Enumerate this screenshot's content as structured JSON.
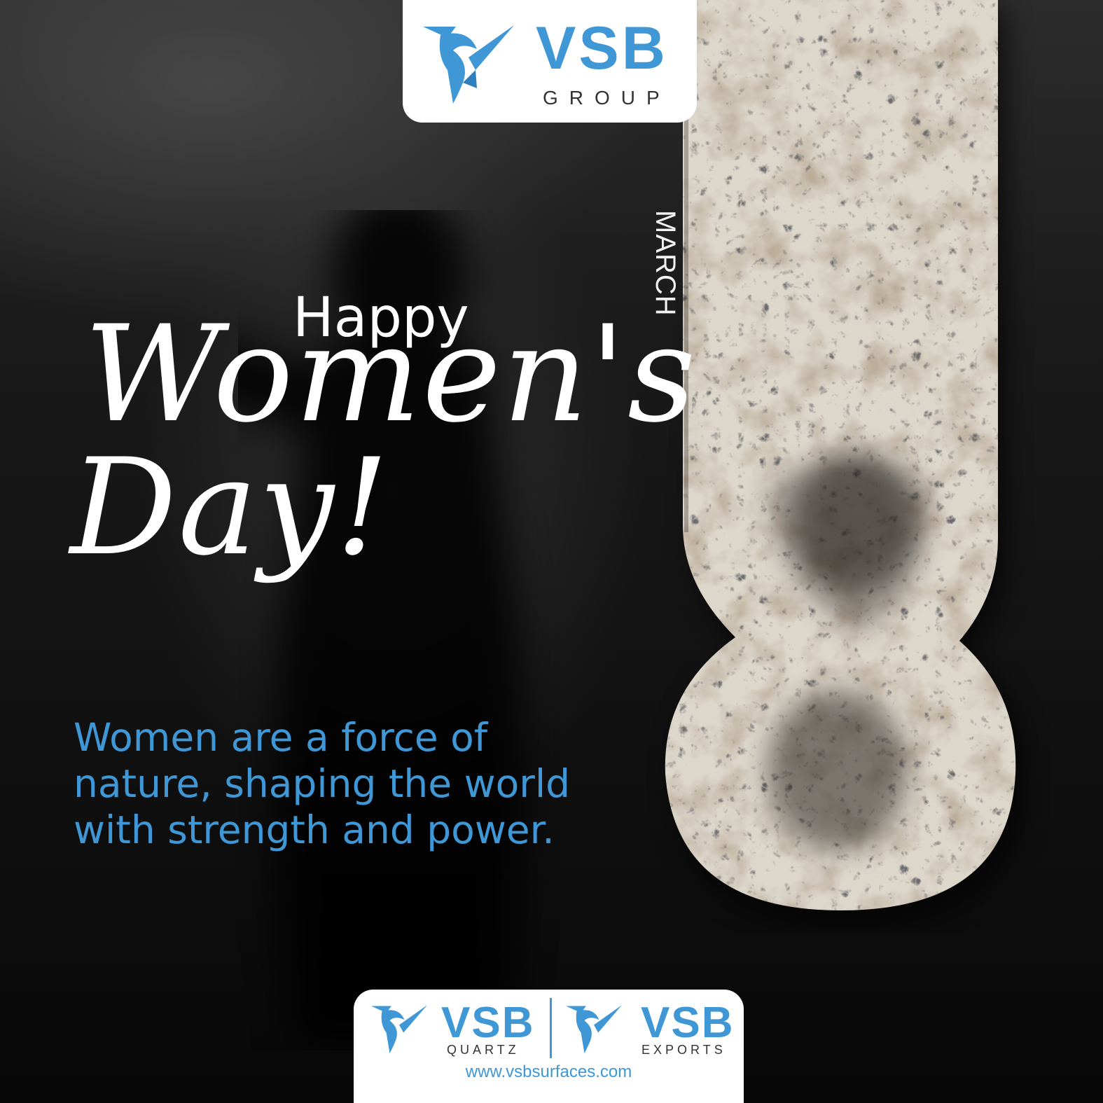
{
  "header_logo": {
    "brand": "VSB",
    "subtitle": "GROUP",
    "icon": "vsb-logo-mark-icon"
  },
  "date_panel": {
    "month": "MARCH",
    "day_numeral": "8",
    "material": "granite"
  },
  "greeting": {
    "line1": "Happy",
    "line2": "Women's",
    "line3": "Day!"
  },
  "tagline": {
    "lines": [
      "Women are a force of",
      "nature, shaping the world",
      "with strength and power."
    ]
  },
  "footer_logos": {
    "left": {
      "brand": "VSB",
      "subtitle": "QUARTZ",
      "icon": "vsb-logo-mark-icon"
    },
    "right": {
      "brand": "VSB",
      "subtitle": "EXPORTS",
      "icon": "vsb-logo-mark-icon"
    },
    "url": "www.vsbsurfaces.com"
  },
  "colors": {
    "brand_blue": "#3f97d6",
    "background": "#111111",
    "text_white": "#ffffff"
  }
}
